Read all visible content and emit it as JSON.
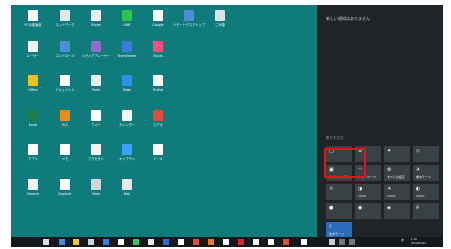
{
  "desktop": {
    "icons": [
      {
        "label": "PCの最適化",
        "color": "#ffffff"
      },
      {
        "label": "ネットワーク",
        "color": "#dfe6ea"
      },
      {
        "label": "Skype",
        "color": "#e8eef2"
      },
      {
        "label": "LINE",
        "color": "#2ec34c"
      },
      {
        "label": "Google",
        "color": "#ffffff"
      },
      {
        "label": "リモートデスクトップ",
        "color": "#4d8fd6"
      },
      {
        "label": "ごみ箱",
        "color": "#dce3e6"
      },
      {
        "label": "ユーザー",
        "color": "#f2f2f2"
      },
      {
        "label": "コントロール",
        "color": "#4d8fd6"
      },
      {
        "label": "メディアプレーヤー",
        "color": "#8e6cc9"
      },
      {
        "label": "TeamViewer",
        "color": "#3b7bd8"
      },
      {
        "label": "iTunes",
        "color": "#ff4b7d"
      },
      {
        "label": "Office",
        "color": "#f2c21c"
      },
      {
        "label": "ドキュメント",
        "color": "#ffffff"
      },
      {
        "label": "Paint",
        "color": "#e9eef0"
      },
      {
        "label": "Edge",
        "color": "#2f8ee6"
      },
      {
        "label": "Firefox",
        "color": "#ffffff"
      },
      {
        "label": "Excel",
        "color": "#1e7d45"
      },
      {
        "label": "VLC",
        "color": "#f08a1a"
      },
      {
        "label": "フォト",
        "color": "#ffffff"
      },
      {
        "label": "カレンダー",
        "color": "#f4f4f4"
      },
      {
        "label": "ビデオ",
        "color": "#e84a3c"
      },
      {
        "label": "アプリ",
        "color": "#ffffff"
      },
      {
        "label": "メモ",
        "color": "#ffffff"
      },
      {
        "label": "アクセサリ",
        "color": "#f3f3f3"
      },
      {
        "label": "キャプチャ",
        "color": "#3fa0ff"
      },
      {
        "label": "ツール",
        "color": "#ffffff"
      },
      {
        "label": "Chrome",
        "color": "#f2f2f2"
      },
      {
        "label": "Explorer",
        "color": "#ffffff"
      },
      {
        "label": "Store",
        "color": "#cfd7da"
      },
      {
        "label": "Mail",
        "color": "#e6e9ea"
      }
    ]
  },
  "action_center": {
    "notice": "新しい通知はありません",
    "collapse_label": "折りたたむ",
    "quick_actions": [
      {
        "label": "",
        "icon": "□"
      },
      {
        "label": "",
        "icon": "⚙"
      },
      {
        "label": "",
        "icon": "✦"
      },
      {
        "label": "",
        "icon": "◇"
      },
      {
        "label": "タブレットモード",
        "icon": "▣"
      },
      {
        "label": "ネットワーク",
        "icon": "◠"
      },
      {
        "label": "すべての設定",
        "icon": "⚙"
      },
      {
        "label": "機内モード",
        "icon": "✈"
      },
      {
        "label": "",
        "icon": "☼"
      },
      {
        "label": "100%",
        "icon": "◑"
      },
      {
        "label": "100%",
        "icon": "☀"
      },
      {
        "label": "100%",
        "icon": "◐"
      },
      {
        "label": "",
        "icon": "●"
      },
      {
        "label": "",
        "icon": "◉"
      },
      {
        "label": "",
        "icon": "◈"
      },
      {
        "label": "",
        "icon": "⌾"
      },
      {
        "label": "集中モード",
        "icon": "☾"
      }
    ],
    "active_index": 16,
    "highlight_index": 4
  },
  "taskbar": {
    "clock_time": "1:16",
    "clock_date": "2019/03/01"
  },
  "colors": {
    "desktop_bg": "#0f7b7a",
    "panel_bg": "#1f2527",
    "taskbar_bg": "#15191b",
    "highlight": "#e3121b",
    "accent": "#2b6cb8"
  }
}
